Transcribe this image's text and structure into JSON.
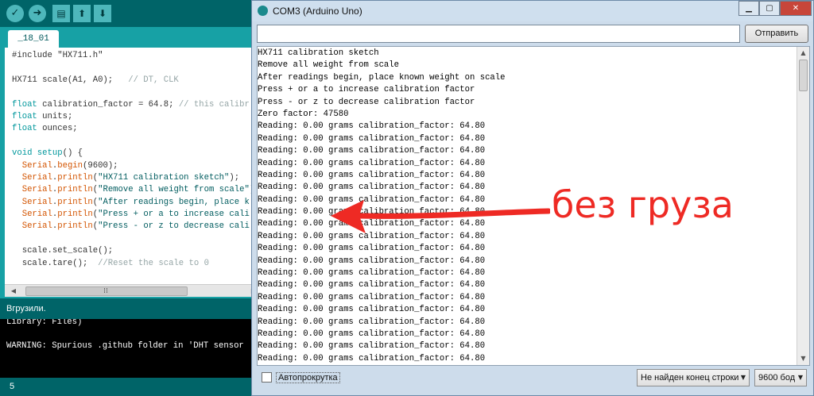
{
  "ide": {
    "tab_label": "_18_01",
    "code_lines": [
      {
        "parts": [
          {
            "t": "#include \"HX711.h\"",
            "c": ""
          }
        ]
      },
      {
        "parts": [
          {
            "t": "",
            "c": ""
          }
        ]
      },
      {
        "parts": [
          {
            "t": "HX711 scale(A1, A0);   ",
            "c": ""
          },
          {
            "t": "// DT, CLK",
            "c": "cm"
          }
        ]
      },
      {
        "parts": [
          {
            "t": "",
            "c": ""
          }
        ]
      },
      {
        "parts": [
          {
            "t": "float",
            "c": "kw"
          },
          {
            "t": " calibration_factor = 64.8; ",
            "c": ""
          },
          {
            "t": "// this calibr",
            "c": "cm"
          }
        ]
      },
      {
        "parts": [
          {
            "t": "float",
            "c": "kw"
          },
          {
            "t": " units;",
            "c": ""
          }
        ]
      },
      {
        "parts": [
          {
            "t": "float",
            "c": "kw"
          },
          {
            "t": " ounces;",
            "c": ""
          }
        ]
      },
      {
        "parts": [
          {
            "t": "",
            "c": ""
          }
        ]
      },
      {
        "parts": [
          {
            "t": "void",
            "c": "kw"
          },
          {
            "t": " ",
            "c": ""
          },
          {
            "t": "setup",
            "c": "kw"
          },
          {
            "t": "() {",
            "c": ""
          }
        ]
      },
      {
        "parts": [
          {
            "t": "  ",
            "c": ""
          },
          {
            "t": "Serial",
            "c": "fn"
          },
          {
            "t": ".",
            "c": ""
          },
          {
            "t": "begin",
            "c": "fn"
          },
          {
            "t": "(9600);",
            "c": ""
          }
        ]
      },
      {
        "parts": [
          {
            "t": "  ",
            "c": ""
          },
          {
            "t": "Serial",
            "c": "fn"
          },
          {
            "t": ".",
            "c": ""
          },
          {
            "t": "println",
            "c": "fn"
          },
          {
            "t": "(",
            "c": ""
          },
          {
            "t": "\"HX711 calibration sketch\"",
            "c": "str"
          },
          {
            "t": ");",
            "c": ""
          }
        ]
      },
      {
        "parts": [
          {
            "t": "  ",
            "c": ""
          },
          {
            "t": "Serial",
            "c": "fn"
          },
          {
            "t": ".",
            "c": ""
          },
          {
            "t": "println",
            "c": "fn"
          },
          {
            "t": "(",
            "c": ""
          },
          {
            "t": "\"Remove all weight from scale\"",
            "c": "str"
          },
          {
            "t": ")",
            "c": ""
          }
        ]
      },
      {
        "parts": [
          {
            "t": "  ",
            "c": ""
          },
          {
            "t": "Serial",
            "c": "fn"
          },
          {
            "t": ".",
            "c": ""
          },
          {
            "t": "println",
            "c": "fn"
          },
          {
            "t": "(",
            "c": ""
          },
          {
            "t": "\"After readings begin, place k",
            "c": "str"
          }
        ]
      },
      {
        "parts": [
          {
            "t": "  ",
            "c": ""
          },
          {
            "t": "Serial",
            "c": "fn"
          },
          {
            "t": ".",
            "c": ""
          },
          {
            "t": "println",
            "c": "fn"
          },
          {
            "t": "(",
            "c": ""
          },
          {
            "t": "\"Press + or a to increase cali",
            "c": "str"
          }
        ]
      },
      {
        "parts": [
          {
            "t": "  ",
            "c": ""
          },
          {
            "t": "Serial",
            "c": "fn"
          },
          {
            "t": ".",
            "c": ""
          },
          {
            "t": "println",
            "c": "fn"
          },
          {
            "t": "(",
            "c": ""
          },
          {
            "t": "\"Press - or z to decrease cali",
            "c": "str"
          }
        ]
      },
      {
        "parts": [
          {
            "t": "",
            "c": ""
          }
        ]
      },
      {
        "parts": [
          {
            "t": "  scale.set_scale();",
            "c": ""
          }
        ]
      },
      {
        "parts": [
          {
            "t": "  scale.tare();  ",
            "c": ""
          },
          {
            "t": "//Reset the scale to 0",
            "c": "cm"
          }
        ]
      }
    ],
    "status_label": "Вгрузили.",
    "console_lines": [
      "Library: Files)",
      "",
      "WARNING: Spurious .github folder in 'DHT sensor"
    ],
    "footer_line": "5"
  },
  "serial": {
    "title": "COM3 (Arduino Uno)",
    "send_value": "",
    "send_label": "Отправить",
    "output_lines": [
      "HX711 calibration sketch",
      "Remove all weight from scale",
      "After readings begin, place known weight on scale",
      "Press + or a to increase calibration factor",
      "Press - or z to decrease calibration factor",
      "Zero factor: 47580",
      "Reading: 0.00 grams calibration_factor: 64.80",
      "Reading: 0.00 grams calibration_factor: 64.80",
      "Reading: 0.00 grams calibration_factor: 64.80",
      "Reading: 0.00 grams calibration_factor: 64.80",
      "Reading: 0.00 grams calibration_factor: 64.80",
      "Reading: 0.00 grams calibration_factor: 64.80",
      "Reading: 0.00 grams calibration_factor: 64.80",
      "Reading: 0.00 grams calibration_factor: 64.80",
      "Reading: 0.00 grams calibration_factor: 64.80",
      "Reading: 0.00 grams calibration_factor: 64.80",
      "Reading: 0.00 grams calibration_factor: 64.80",
      "Reading: 0.00 grams calibration_factor: 64.80",
      "Reading: 0.00 grams calibration_factor: 64.80",
      "Reading: 0.00 grams calibration_factor: 64.80",
      "Reading: 0.00 grams calibration_factor: 64.80",
      "Reading: 0.00 grams calibration_factor: 64.80",
      "Reading: 0.00 grams calibration_factor: 64.80",
      "Reading: 0.00 grams calibration_factor: 64.80",
      "Reading: 0.00 grams calibration_factor: 64.80",
      "Reading: 0.00 grams calibration_factor: 64.80"
    ],
    "autoscroll_label": "Автопрокрутка",
    "line_ending": "Не найден конец строки",
    "baud": "9600 бод"
  },
  "annotation": {
    "text": "без груза",
    "color": "#ee2a24"
  },
  "icons": {
    "verify": "check-icon",
    "upload": "arrow-right-icon",
    "new": "new-file-icon",
    "open": "open-icon",
    "save": "save-icon"
  }
}
